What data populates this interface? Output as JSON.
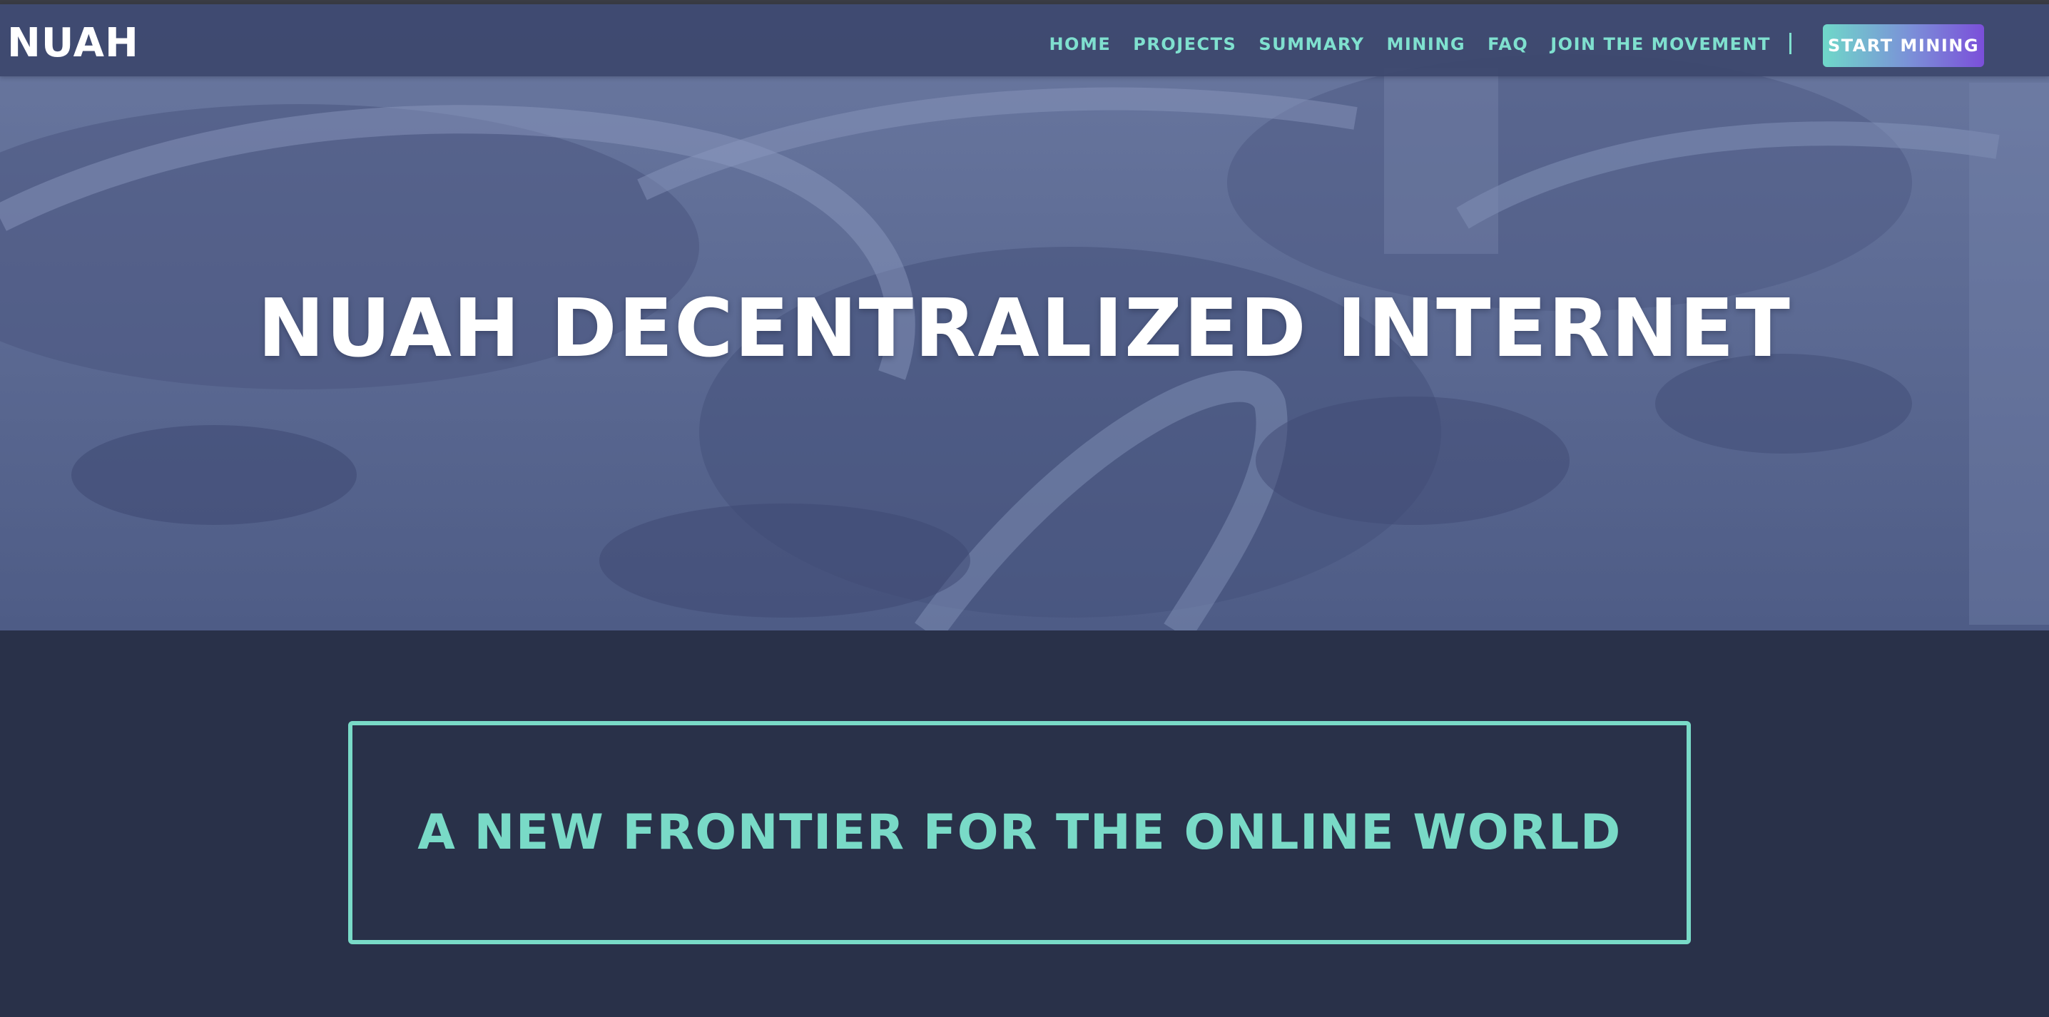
{
  "brand": {
    "logo_text": "NUAH"
  },
  "nav": {
    "items": [
      {
        "label": "HOME"
      },
      {
        "label": "PROJECTS"
      },
      {
        "label": "SUMMARY"
      },
      {
        "label": "MINING"
      },
      {
        "label": "FAQ"
      },
      {
        "label": "JOIN THE MOVEMENT"
      }
    ],
    "cta_label": "START MINING"
  },
  "hero": {
    "title": "NUAH DECENTRALIZED INTERNET"
  },
  "section": {
    "headline": "A NEW FRONTIER FOR THE ONLINE WORLD"
  },
  "colors": {
    "accent": "#79dac7",
    "page_background": "#293149",
    "hero_overlay": "#5a6892",
    "cta_gradient_start": "#6fd8c9",
    "cta_gradient_end": "#7b4fd9"
  }
}
